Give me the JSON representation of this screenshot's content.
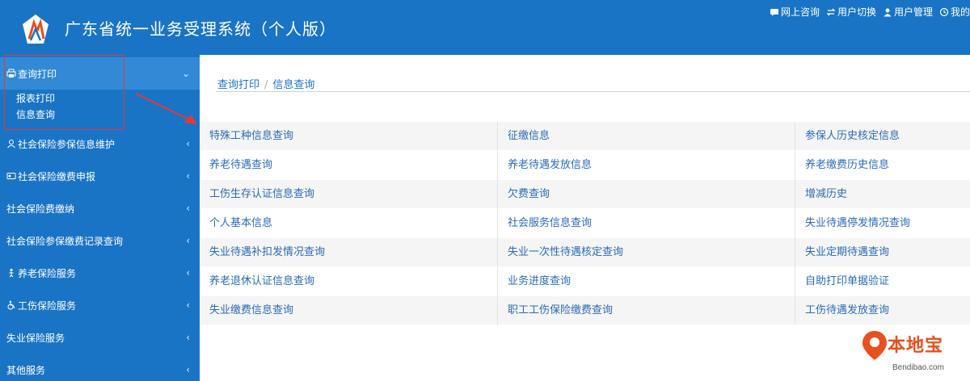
{
  "header": {
    "title": "广东省统一业务受理系统（个人版）",
    "links": [
      {
        "label": "网上咨询",
        "icon": "chat-icon"
      },
      {
        "label": "用户切换",
        "icon": "switch-icon"
      },
      {
        "label": "用户管理",
        "icon": "user-icon"
      },
      {
        "label": "我的",
        "icon": "history-icon"
      }
    ]
  },
  "sidebar": {
    "active": {
      "label": "查询打印",
      "sub": [
        "报表打印",
        "信息查询"
      ]
    },
    "items": [
      {
        "label": "社会保险参保信息维护"
      },
      {
        "label": "社会保险缴费申报"
      },
      {
        "label": "社会保险费缴纳"
      },
      {
        "label": "社会保险参保缴费记录查询"
      },
      {
        "label": "养老保险服务"
      },
      {
        "label": "工伤保险服务"
      },
      {
        "label": "失业保险服务"
      },
      {
        "label": "其他服务"
      }
    ]
  },
  "main": {
    "breadcrumb": [
      "查询打印",
      "信息查询"
    ],
    "rows": [
      [
        "特殊工种信息查询",
        "征缴信息",
        "参保人历史核定信息"
      ],
      [
        "养老待遇查询",
        "养老待遇发放信息",
        "养老缴费历史信息"
      ],
      [
        "工伤生存认证信息查询",
        "欠费查询",
        "增减历史"
      ],
      [
        "个人基本信息",
        "社会服务信息查询",
        "失业待遇停发情况查询"
      ],
      [
        "失业待遇补扣发情况查询",
        "失业一次性待遇核定查询",
        "失业定期待遇查询"
      ],
      [
        "养老退休认证信息查询",
        "业务进度查询",
        "自助打印单据验证"
      ],
      [
        "失业缴费信息查询",
        "职工工伤保险缴费查询",
        "工伤待遇发放查询"
      ]
    ]
  },
  "watermark": {
    "text": "本地宝",
    "sub": "Bendibao.com"
  },
  "colors": {
    "primary": "#1a74c6",
    "active": "#3289d6",
    "link": "#2a6bb8",
    "highlight": "#e53935"
  }
}
